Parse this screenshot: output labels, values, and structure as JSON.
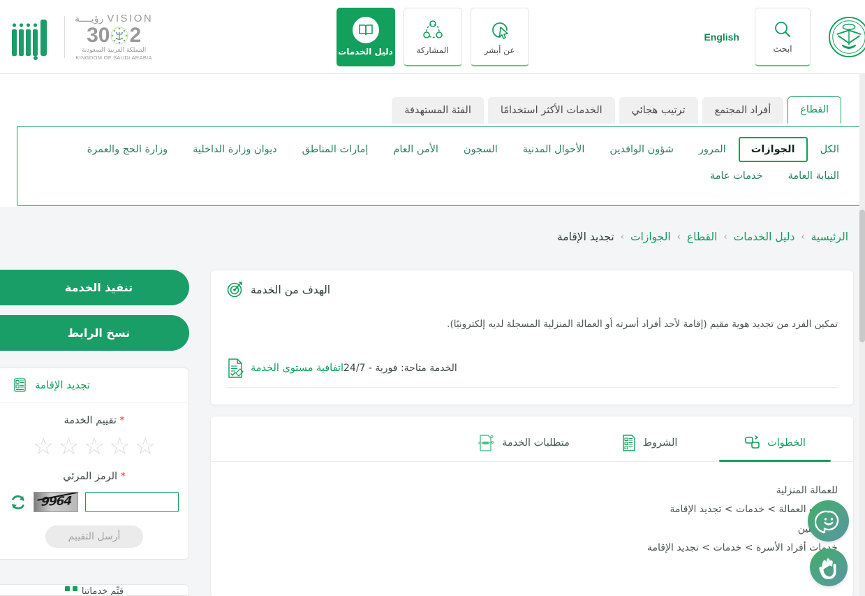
{
  "header": {
    "emblem_alt": "saudi-national-emblem",
    "search_label": "ابحث",
    "language_toggle": "English",
    "nav_cards": [
      {
        "label": "دليل الخدمات",
        "icon": "book-icon",
        "active": true
      },
      {
        "label": "المشاركة",
        "icon": "share-network-icon",
        "active": false
      },
      {
        "label": "عن أبشر",
        "icon": "cursor-circle-icon",
        "active": false
      }
    ],
    "vision": {
      "word_en": "VISION",
      "word_ar": "رؤيــــة",
      "year_left": "2",
      "year_right": "30",
      "kingdom_ar": "المملكة العربية السعودية",
      "kingdom_en": "KINGDOM OF SAUDI ARABIA"
    },
    "absher_alt": "absher-logo"
  },
  "tabs": [
    {
      "label": "القطاع",
      "active": true
    },
    {
      "label": "أفراد المجتمع",
      "active": false
    },
    {
      "label": "ترتيب هجائي",
      "active": false
    },
    {
      "label": "الخدمات الأكثر استخدامًا",
      "active": false
    },
    {
      "label": "الفئة المستهدفة",
      "active": false
    }
  ],
  "filters": [
    {
      "label": "الكل",
      "selected": false
    },
    {
      "label": "الجوازات",
      "selected": true
    },
    {
      "label": "المرور",
      "selected": false
    },
    {
      "label": "شؤون الوافدين",
      "selected": false
    },
    {
      "label": "الأحوال المدنية",
      "selected": false
    },
    {
      "label": "السجون",
      "selected": false
    },
    {
      "label": "الأمن العام",
      "selected": false
    },
    {
      "label": "إمارات المناطق",
      "selected": false
    },
    {
      "label": "ديوان وزارة الداخلية",
      "selected": false
    },
    {
      "label": "وزارة الحج والعمرة",
      "selected": false
    },
    {
      "label": "النيابة العامة",
      "selected": false
    },
    {
      "label": "خدمات عامة",
      "selected": false
    }
  ],
  "breadcrumb": {
    "items": [
      "الرئيسية",
      "دليل الخدمات",
      "القطاع",
      "الجوازات"
    ],
    "current": "تجديد الإقامة",
    "separator": "›"
  },
  "sidebar": {
    "execute_button": "تنفيذ الخدمة",
    "copy_link_button": "نسخ الرابط",
    "rating_card": {
      "title": "تجديد الإقامة",
      "title_icon": "service-form-icon",
      "rating_label": "تقييم الخدمة",
      "required_mark": "*",
      "stars": [
        "☆",
        "☆",
        "☆",
        "☆",
        "☆"
      ],
      "captcha_label": "الرمز المرئي",
      "captcha_required_mark": "*",
      "captcha_value": "9964",
      "captcha_input_value": "",
      "refresh_icon": "refresh-icon",
      "submit_label": "أرسل التقييم",
      "submit_disabled": true
    },
    "peek_text": "قيِّم خدماتنا"
  },
  "main": {
    "goal": {
      "icon": "target-icon",
      "title": "الهدف من الخدمة",
      "description": "تمكين الفرد من تجديد هوية مقيم (إقامة لأحد أفراد أسرته أو العمالة المنزلية المسجلة لديه إلكترونيًا).",
      "sla_link": "اتفاقية مستوى الخدمة",
      "sla_icon": "document-check-icon",
      "availability": "الخدمة متاحة: فورية - 24/7"
    },
    "content_tabs": [
      {
        "label": "الخطوات",
        "icon": "steps-icon",
        "active": true
      },
      {
        "label": "الشروط",
        "icon": "conditions-doc-icon",
        "active": false
      },
      {
        "label": "متطلبات الخدمة",
        "icon": "requirements-icon",
        "active": false
      }
    ],
    "steps_lines": [
      "للعمالة المنزلية",
      "خدمات العمالة > خدمات > تجديد الإقامة",
      "للمرافقين",
      "خدمات أفراد الأسرة > خدمات > تجديد الإقامة"
    ]
  },
  "floating_buttons": [
    {
      "name": "chatbot-assistant-button",
      "icon": "smiley-assistant-icon"
    },
    {
      "name": "sign-language-button",
      "icon": "hands-sign-language-icon"
    }
  ],
  "colors": {
    "brand_green": "#12a05c",
    "green_dark": "#0f8a55",
    "accent_green": "#1a9e68",
    "text_dark": "#3c4043",
    "required_red": "#e03b36",
    "page_bg": "#f4f5f7"
  }
}
